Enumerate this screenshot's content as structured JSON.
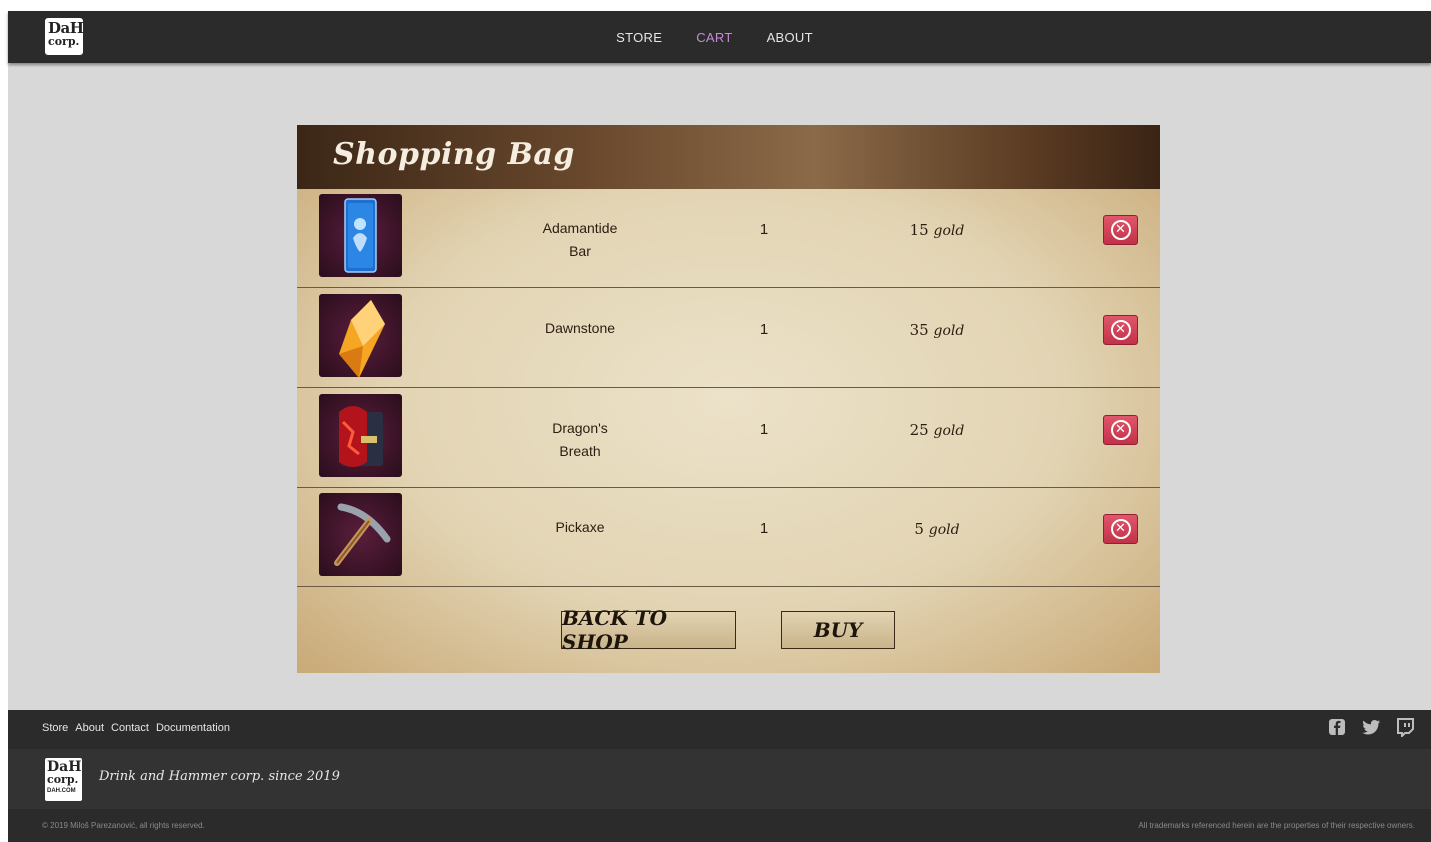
{
  "header": {
    "logo_line1": "DaH",
    "logo_line2": "corp.",
    "nav": [
      {
        "label": "STORE",
        "active": false
      },
      {
        "label": "CART",
        "active": true
      },
      {
        "label": "ABOUT",
        "active": false
      }
    ]
  },
  "panel": {
    "title": "Shopping Bag",
    "items": [
      {
        "name_line1": "Adamantide",
        "name_line2": "Bar",
        "quantity": "1",
        "price": "15",
        "currency": "gold",
        "image": "adamantide-bar-icon"
      },
      {
        "name_line1": "Dawnstone",
        "name_line2": "",
        "quantity": "1",
        "price": "35",
        "currency": "gold",
        "image": "dawnstone-crystal-icon"
      },
      {
        "name_line1": "Dragon's",
        "name_line2": "Breath",
        "quantity": "1",
        "price": "25",
        "currency": "gold",
        "image": "dragons-breath-book-icon"
      },
      {
        "name_line1": "Pickaxe",
        "name_line2": "",
        "quantity": "1",
        "price": "5",
        "currency": "gold",
        "image": "pickaxe-icon"
      }
    ],
    "remove_icon": "remove-circle-x-icon",
    "back_label": "BACK TO SHOP",
    "buy_label": "BUY"
  },
  "footer": {
    "links": [
      "Store",
      "About",
      "Contact",
      "Documentation"
    ],
    "social": [
      "facebook-icon",
      "twitter-icon",
      "twitch-icon"
    ],
    "logo_line1": "DaH",
    "logo_line2": "corp.",
    "logo_line3": "DAH.COM",
    "tagline": "Drink and Hammer corp. since 2019",
    "copyright": "© 2019 Miloš Parezanović, all rights reserved.",
    "trademark": "All trademarks referenced herein are the properties of their respective owners."
  },
  "colors": {
    "header_bg": "#2b2b2b",
    "page_bg": "#d8d8d8",
    "nav_active": "#c98ad8",
    "remove_button": "#d4405a"
  }
}
